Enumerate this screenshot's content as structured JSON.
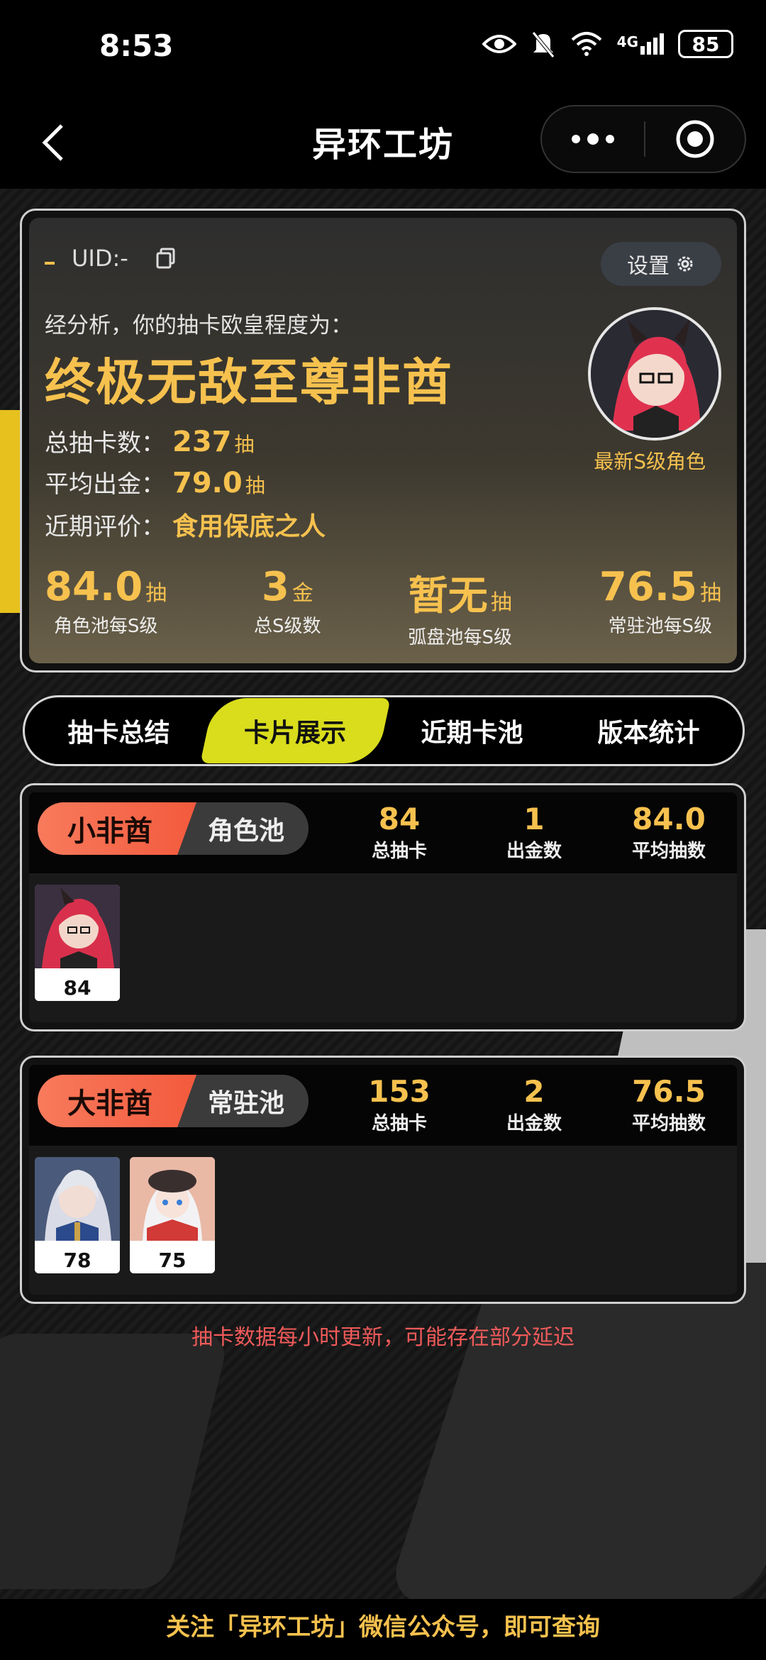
{
  "status_bar": {
    "time": "8:53",
    "network": "4G",
    "battery": "85"
  },
  "navbar": {
    "title": "异环工坊"
  },
  "summary": {
    "uid_label": "UID:-",
    "settings_label": "设置",
    "analysis_text": "经分析，你的抽卡欧皇程度为：",
    "verdict": "终极无敌至尊非酋",
    "total_pulls_label": "总抽卡数：",
    "total_pulls_value": "237",
    "avg_gold_label": "平均出金：",
    "avg_gold_value": "79.0",
    "recent_label": "近期评价：",
    "recent_value": "食用保底之人",
    "pull_unit": "抽",
    "latest_label": "最新S级角色",
    "bottom_stats": [
      {
        "value": "84.0",
        "unit": "抽",
        "label": "角色池每S级"
      },
      {
        "value": "3",
        "unit": "金",
        "label": "总S级数"
      },
      {
        "value": "暂无",
        "unit": "抽",
        "label": "弧盘池每S级"
      },
      {
        "value": "76.5",
        "unit": "抽",
        "label": "常驻池每S级"
      }
    ]
  },
  "tabs": [
    {
      "label": "抽卡总结",
      "active": false
    },
    {
      "label": "卡片展示",
      "active": true
    },
    {
      "label": "近期卡池",
      "active": false
    },
    {
      "label": "版本统计",
      "active": false
    }
  ],
  "pools": [
    {
      "rank": "小非酋",
      "name": "角色池",
      "stats": [
        {
          "value": "84",
          "label": "总抽卡"
        },
        {
          "value": "1",
          "label": "出金数"
        },
        {
          "value": "84.0",
          "label": "平均抽数"
        }
      ],
      "cards": [
        {
          "count": "84"
        }
      ]
    },
    {
      "rank": "大非酋",
      "name": "常驻池",
      "stats": [
        {
          "value": "153",
          "label": "总抽卡"
        },
        {
          "value": "2",
          "label": "出金数"
        },
        {
          "value": "76.5",
          "label": "平均抽数"
        }
      ],
      "cards": [
        {
          "count": "78"
        },
        {
          "count": "75"
        }
      ]
    }
  ],
  "notice": "抽卡数据每小时更新，可能存在部分延迟",
  "footer": "关注「异环工坊」微信公众号，即可查询"
}
